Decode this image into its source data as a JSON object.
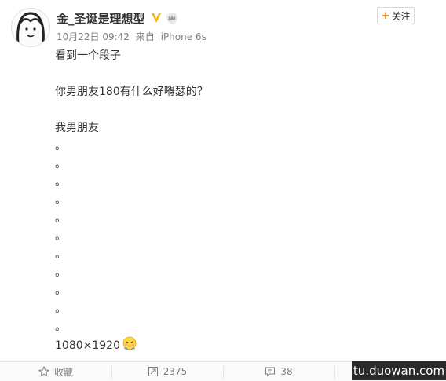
{
  "post": {
    "author_name": "金_圣诞是理想型",
    "timestamp": "10月22日 09:42",
    "source_prefix": "来自",
    "source": "iPhone 6s",
    "follow_label": "关注",
    "follow_plus": "+",
    "lines": [
      "看到一个段子",
      "",
      "你男朋友180有什么好嘚瑟的？",
      "",
      "我男朋友",
      "。",
      "。",
      "。",
      "。",
      "。",
      "。",
      "。",
      "。",
      "。",
      "。",
      "。"
    ],
    "last_line": "1080×1920",
    "emoji_icon": "shy-smile-emoji-icon"
  },
  "actions": {
    "favorite_label": "收藏",
    "repost_count": "2375",
    "comment_count": "38"
  },
  "watermark": "tu.duowan.com",
  "colors": {
    "accent_orange": "#ff8200",
    "verified_gold": "#f7b500",
    "meta_gray": "#808080"
  }
}
